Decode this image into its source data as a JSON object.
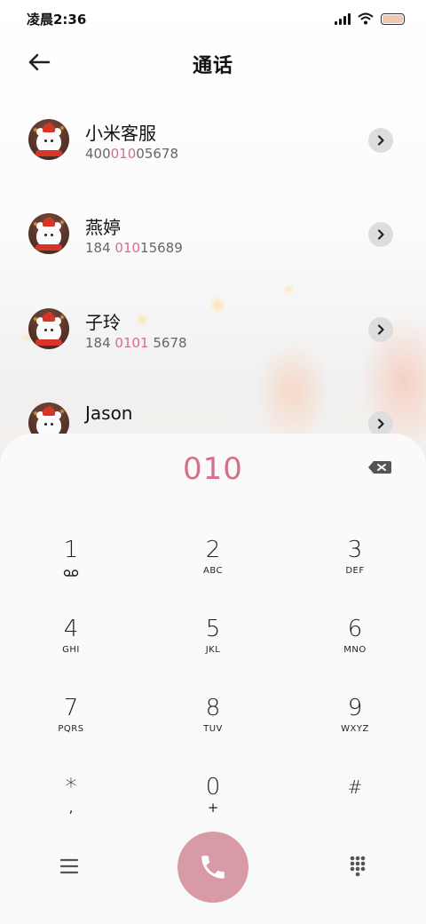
{
  "status_bar": {
    "time": "凌晨2:36",
    "battery_color": "#f0c9b6"
  },
  "header": {
    "title": "通话",
    "back_icon": "arrow-left-icon"
  },
  "contacts": [
    {
      "name": "小米客服",
      "number_pre": "400",
      "number_match": "010",
      "number_post": "05678"
    },
    {
      "name": "燕婷",
      "number_pre": "184 ",
      "number_match": "010",
      "number_post": "15689"
    },
    {
      "name": "子玲",
      "number_pre": "184 ",
      "number_match": "0101",
      "number_post": " 5678"
    },
    {
      "name": "Jason",
      "number_pre": "",
      "number_match": "",
      "number_post": ""
    }
  ],
  "dialpad": {
    "input": "010",
    "keys": [
      {
        "digit": "1",
        "letters": "",
        "icon": "voicemail-icon"
      },
      {
        "digit": "2",
        "letters": "ABC"
      },
      {
        "digit": "3",
        "letters": "DEF"
      },
      {
        "digit": "4",
        "letters": "GHI"
      },
      {
        "digit": "5",
        "letters": "JKL"
      },
      {
        "digit": "6",
        "letters": "MNO"
      },
      {
        "digit": "7",
        "letters": "PQRS"
      },
      {
        "digit": "8",
        "letters": "TUV"
      },
      {
        "digit": "9",
        "letters": "WXYZ"
      },
      {
        "digit": "*",
        "letters": "",
        "sub": ","
      },
      {
        "digit": "0",
        "letters": "",
        "sub": "+"
      },
      {
        "digit": "#",
        "letters": ""
      }
    ]
  },
  "colors": {
    "accent": "#d4708a",
    "call_button": "#d89aa7"
  }
}
